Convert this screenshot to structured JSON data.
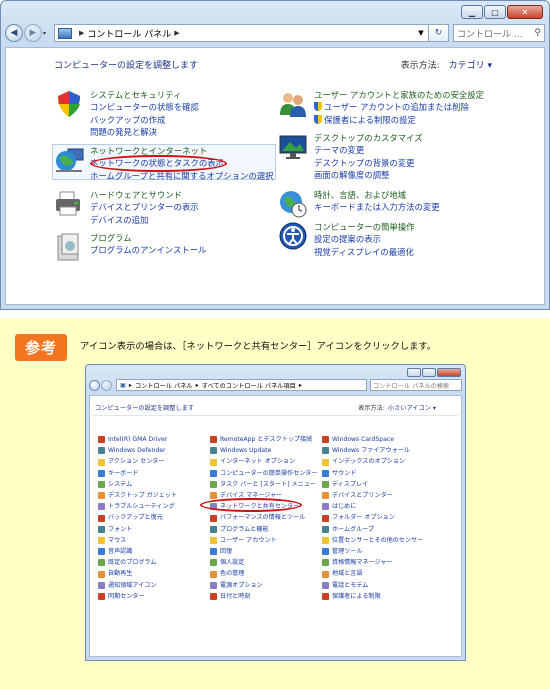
{
  "window": {
    "address": {
      "segments": [
        "コントロール パネル"
      ],
      "search_placeholder": "コントロール ..."
    },
    "content": {
      "heading": "コンピューターの設定を調整します",
      "view_by_label": "表示方法:",
      "view_by_value": "カテゴリ",
      "categories_left": [
        {
          "title": "システムとセキュリティ",
          "links": [
            "コンピューターの状態を確認",
            "バックアップの作成",
            "問題の発見と解決"
          ]
        },
        {
          "title": "ネットワークとインターネット",
          "links": [
            "ネットワークの状態とタスクの表示",
            "ホームグループと共有に関するオプションの選択"
          ]
        },
        {
          "title": "ハードウェアとサウンド",
          "links": [
            "デバイスとプリンターの表示",
            "デバイスの追加"
          ]
        },
        {
          "title": "プログラム",
          "links": [
            "プログラムのアンインストール"
          ]
        }
      ],
      "categories_right": [
        {
          "title": "ユーザー アカウントと家族のための安全設定",
          "links": [
            "ユーザー アカウントの追加または削除",
            "保護者による制限の設定"
          ]
        },
        {
          "title": "デスクトップのカスタマイズ",
          "links": [
            "テーマの変更",
            "デスクトップの背景の変更",
            "画面の解像度の調整"
          ]
        },
        {
          "title": "時計、言語、および地域",
          "links": [
            "キーボードまたは入力方法の変更"
          ]
        },
        {
          "title": "コンピューターの簡単操作",
          "links": [
            "設定の提案の表示",
            "視覚ディスプレイの最適化"
          ]
        }
      ]
    }
  },
  "note": {
    "badge": "参考",
    "text": "アイコン表示の場合は、［ネットワークと共有センター］アイコンをクリックします。"
  },
  "mini_window": {
    "address_segments": [
      "コントロール パネル",
      "すべてのコントロール パネル項目"
    ],
    "search_placeholder": "コントロール パネルの検索",
    "heading": "コンピューターの設定を調整します",
    "view_by_label": "表示方法:",
    "view_by_value": "小さいアイコン",
    "col1": [
      "Intel(R) GMA Driver",
      "Windows Defender",
      "アクション センター",
      "キーボード",
      "システム",
      "デスクトップ ガジェット",
      "トラブルシューティング",
      "バックアップと復元",
      "フォント",
      "マウス",
      "音声認識",
      "既定のプログラム",
      "自動再生",
      "通知領域アイコン",
      "同期センター"
    ],
    "col2": [
      "RemoteApp とデスクトップ接続",
      "Windows Update",
      "インターネット オプション",
      "コンピューターの簡単操作センター",
      "タスク バーと [スタート] メニュー",
      "デバイス マネージャー",
      "ネットワークと共有センター",
      "パフォーマンスの情報とツール",
      "プログラムと機能",
      "ユーザー アカウント",
      "回復",
      "個人設定",
      "色の管理",
      "電源オプション",
      "日付と時刻"
    ],
    "col3": [
      "Windows CardSpace",
      "Windows ファイアウォール",
      "インデックスのオプション",
      "サウンド",
      "ディスプレイ",
      "デバイスとプリンター",
      "はじめに",
      "フォルダー オプション",
      "ホームグループ",
      "位置センサーとその他のセンサー",
      "管理ツール",
      "資格情報マネージャー",
      "地域と言語",
      "電話とモデム",
      "保護者による制限"
    ]
  }
}
